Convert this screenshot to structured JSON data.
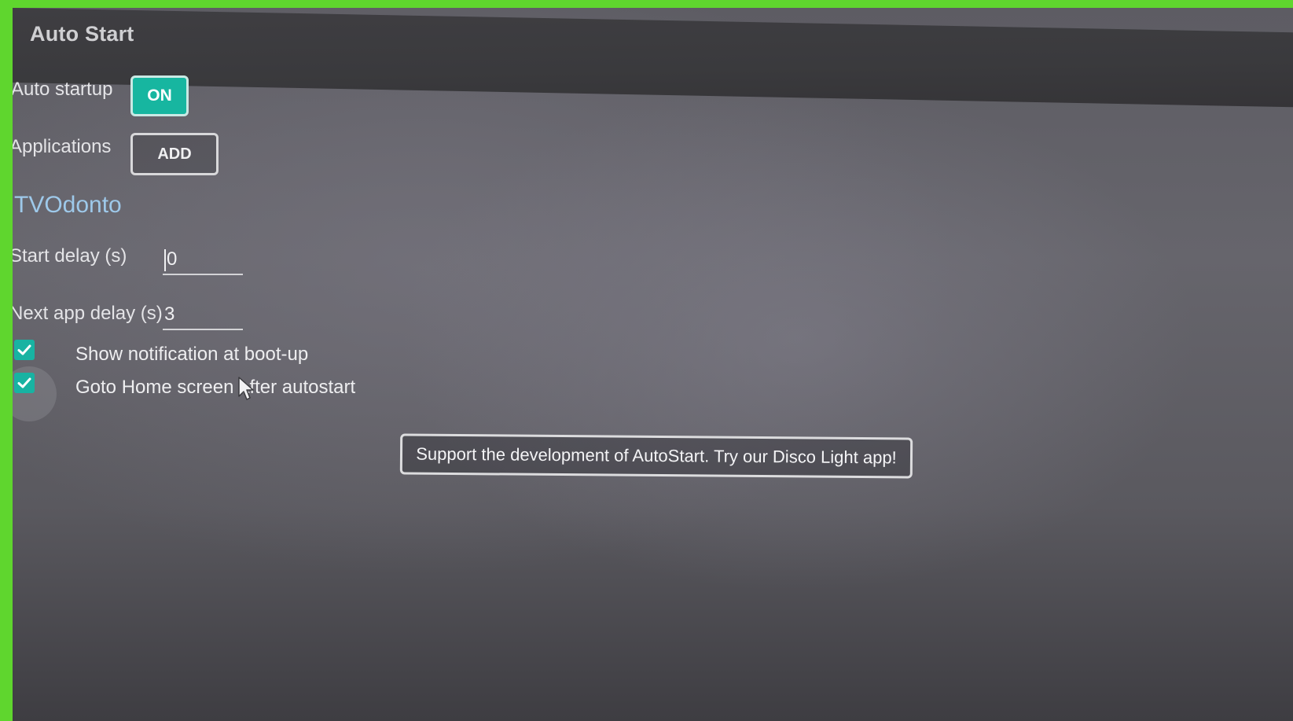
{
  "window": {
    "title": "Auto Start"
  },
  "settings": {
    "auto_startup": {
      "label": "Auto startup",
      "value": "ON",
      "state": true
    },
    "applications": {
      "label": "Applications",
      "add_label": "ADD",
      "items": [
        "TVOdonto"
      ]
    },
    "start_delay": {
      "label": "Start delay (s)",
      "value": "0"
    },
    "next_app_delay": {
      "label": "Next app delay (s)",
      "value": "3"
    },
    "checkboxes": [
      {
        "label": "Show notification at boot-up",
        "checked": true
      },
      {
        "label": "Goto Home screen after autostart",
        "checked": true
      }
    ]
  },
  "promo": {
    "label": "Support the development of AutoStart. Try our Disco Light app!"
  },
  "colors": {
    "frame": "#5fd62e",
    "accent": "#17b6a0",
    "app_name": "#9ec9ea",
    "background": "#5d5c63"
  },
  "icons": {
    "check": "check-icon",
    "cursor": "mouse-pointer-icon"
  }
}
